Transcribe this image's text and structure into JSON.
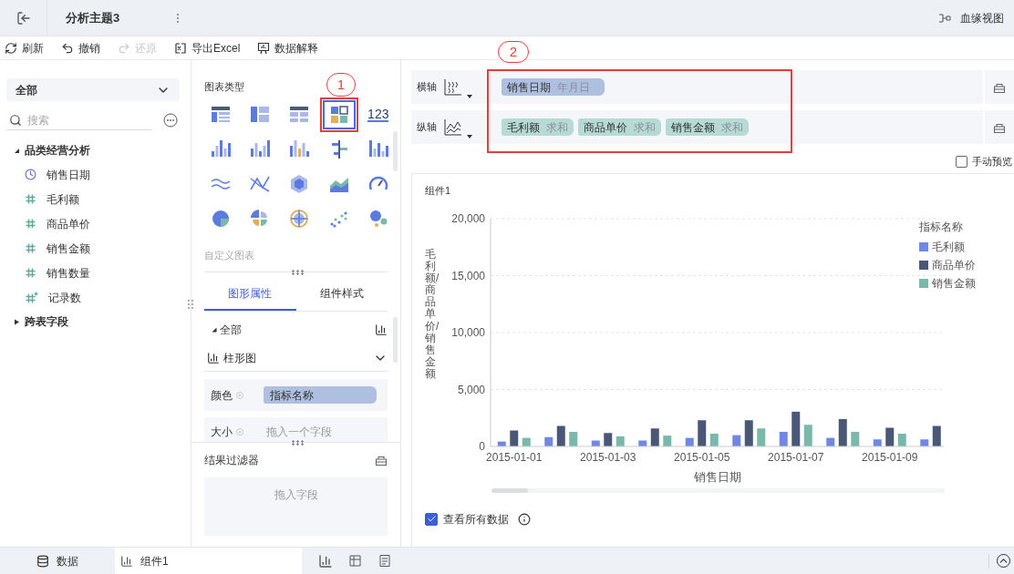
{
  "header": {
    "title": "分析主题3",
    "lineage_link": "血缘视图"
  },
  "toolbar": [
    {
      "kind": "refresh",
      "label": "刷新",
      "disabled": false
    },
    {
      "kind": "undo",
      "label": "撤销",
      "disabled": false
    },
    {
      "kind": "redo",
      "label": "还原",
      "disabled": true
    },
    {
      "kind": "excel",
      "label": "导出Excel",
      "disabled": false
    },
    {
      "kind": "explain",
      "label": "数据解释",
      "disabled": false
    }
  ],
  "field_panel": {
    "scope": "全部",
    "search_placeholder": "搜索",
    "tree": [
      {
        "label": "品类经营分析",
        "expanded": true,
        "children": [
          {
            "kind": "date",
            "label": "销售日期"
          },
          {
            "kind": "number",
            "label": "毛利额"
          },
          {
            "kind": "number",
            "label": "商品单价"
          },
          {
            "kind": "number",
            "label": "销售金额"
          },
          {
            "kind": "number",
            "label": "销售数量"
          },
          {
            "kind": "count",
            "label": "记录数"
          }
        ]
      },
      {
        "label": "跨表字段",
        "expanded": false
      }
    ]
  },
  "chart_types": {
    "title": "图表类型",
    "custom": "自定义图表",
    "items": [
      {
        "selected": false
      },
      {
        "selected": false
      },
      {
        "selected": false
      },
      {
        "selected": true
      },
      {
        "label": "123",
        "selected": false
      },
      {
        "selected": false
      },
      {
        "selected": false
      },
      {
        "selected": false
      },
      {
        "selected": false
      },
      {
        "selected": false
      },
      {
        "selected": false
      },
      {
        "selected": false
      },
      {
        "selected": false
      },
      {
        "selected": false
      },
      {
        "selected": false
      },
      {
        "selected": false
      },
      {
        "selected": false
      },
      {
        "selected": false
      },
      {
        "selected": false
      },
      {
        "selected": false
      }
    ]
  },
  "property_tabs": [
    {
      "label": "图形属性",
      "selected": true
    },
    {
      "label": "组件样式",
      "selected": false
    }
  ],
  "properties": {
    "section": "全部",
    "chart_kind": "柱形图",
    "rows": [
      {
        "label": "颜色",
        "value": "指标名称"
      },
      {
        "label": "大小",
        "placeholder": "拖入一个字段"
      }
    ]
  },
  "result_filter": {
    "title": "结果过滤器",
    "placeholder": "拖入字段"
  },
  "axes": [
    {
      "label": "横轴",
      "pills": [
        {
          "kind": "dimension",
          "name": "销售日期",
          "detail": "年月日"
        }
      ]
    },
    {
      "label": "纵轴",
      "pills": [
        {
          "kind": "measure",
          "name": "毛利额",
          "detail": "求和"
        },
        {
          "kind": "measure",
          "name": "商品单价",
          "detail": "求和"
        },
        {
          "kind": "measure",
          "name": "销售金额",
          "detail": "求和"
        }
      ]
    }
  ],
  "manual_preview": {
    "label": "手动预览",
    "checked": false
  },
  "widget": {
    "title": "组件1",
    "show_all": {
      "label": "查看所有数据",
      "checked": true
    },
    "chart_data": {
      "type": "bar",
      "xlabel": "销售日期",
      "ylabel": "毛利额/商品单价/销售金额",
      "legend_title": "指标名称",
      "categories": [
        "2015-01-01",
        null,
        "2015-01-03",
        null,
        "2015-01-05",
        null,
        "2015-01-07",
        null,
        "2015-01-09",
        null
      ],
      "grid": true,
      "ylim": [
        0,
        20000
      ],
      "yticks": [
        {
          "value": 0,
          "label": "0"
        },
        {
          "value": 5000,
          "label": "5,000"
        },
        {
          "value": 10000,
          "label": "10,000"
        },
        {
          "value": 15000,
          "label": "15,000"
        },
        {
          "value": 20000,
          "label": "20,000"
        }
      ],
      "series": [
        {
          "name": "毛利额",
          "color": "#7088e4",
          "values": [
            430,
            820,
            520,
            520,
            750,
            990,
            1280,
            750,
            620,
            620
          ]
        },
        {
          "name": "商品单价",
          "color": "#4a5878",
          "values": [
            1400,
            1800,
            1180,
            1580,
            2300,
            2300,
            3050,
            2400,
            1640,
            1800
          ]
        },
        {
          "name": "销售金额",
          "color": "#79b8ab",
          "values": [
            750,
            1280,
            890,
            950,
            1120,
            1580,
            1900,
            1280,
            1120,
            null
          ]
        }
      ]
    }
  },
  "annotations": [
    "1",
    "2"
  ],
  "bottom_tabs": [
    {
      "label": "数据",
      "selected": false
    },
    {
      "label": "组件1",
      "selected": true
    }
  ]
}
